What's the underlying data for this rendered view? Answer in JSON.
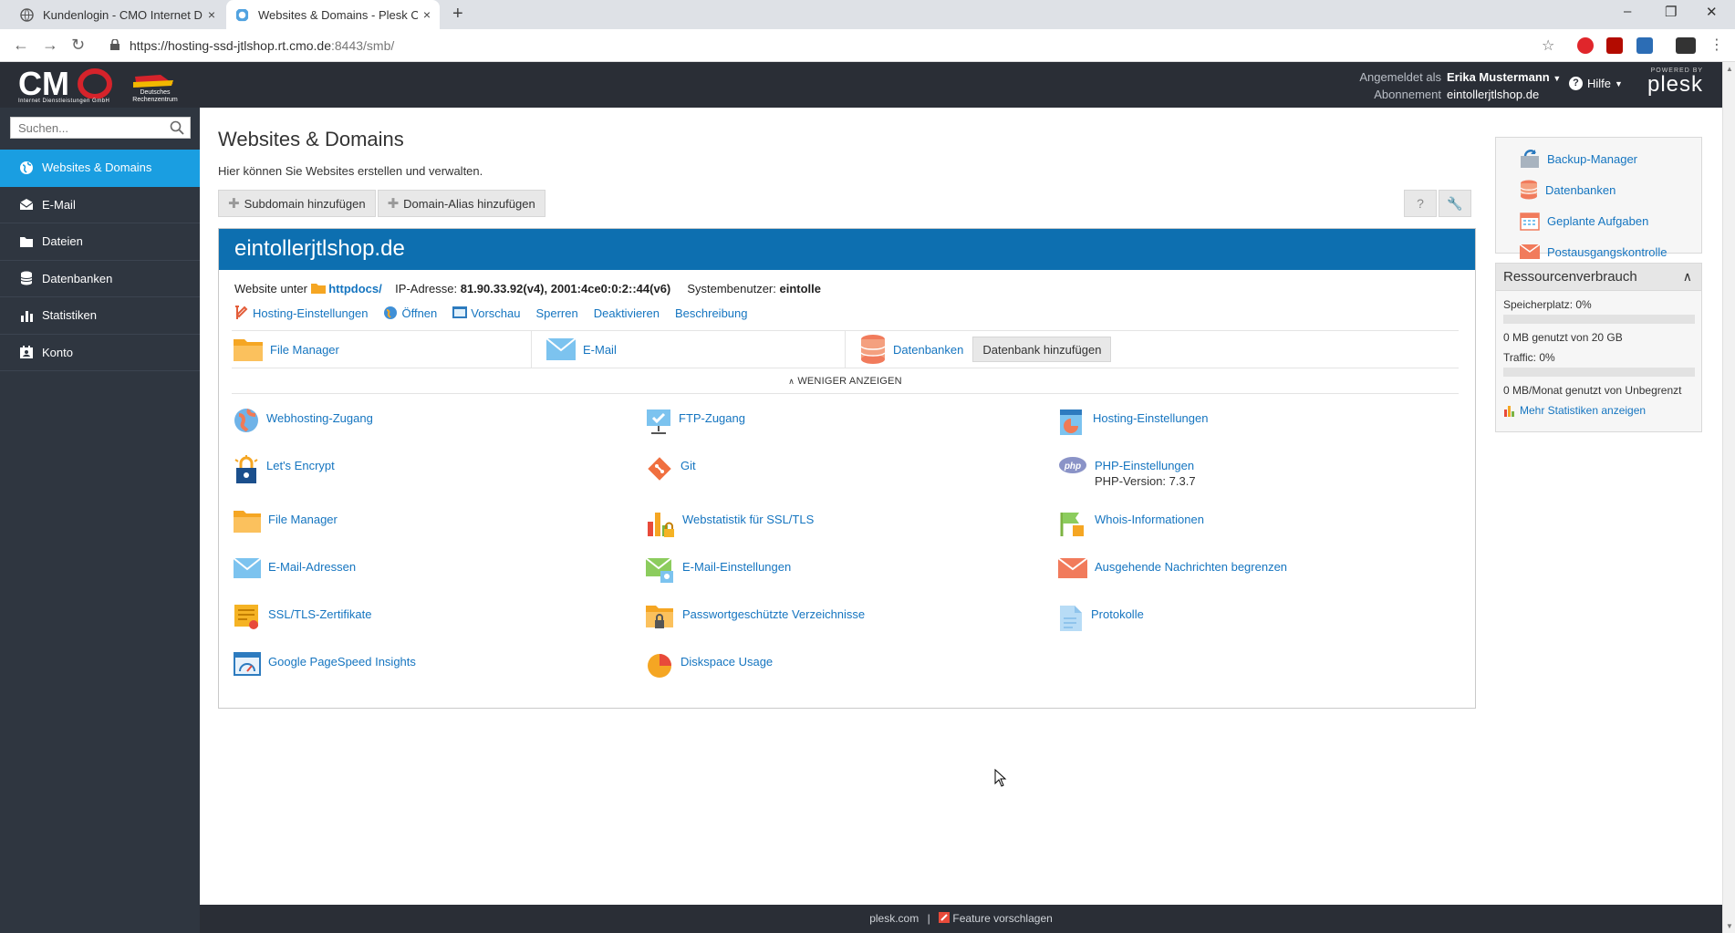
{
  "browser": {
    "tabs": [
      {
        "label": "Kundenlogin - CMO Internet Die",
        "close": "×"
      },
      {
        "label": "Websites & Domains - Plesk Ony",
        "close": "×"
      }
    ],
    "new_tab": "+",
    "url_host": "https://hosting-ssd-jtlshop.rt.cmo.de",
    "url_rest": ":8443/smb/",
    "window_controls": [
      "–",
      "❐",
      "✕"
    ]
  },
  "header": {
    "logo_text": "CMO",
    "logo_sub": "Internet Dienstleistungen GmbH",
    "logo_badge": "Deutsches Rechenzentrum",
    "login_label": "Angemeldet als",
    "login_user": "Erika Mustermann",
    "subscription_label": "Abonnement",
    "subscription_value": "eintollerjtlshop.de",
    "help_label": "Hilfe",
    "powered_by": "POWERED BY",
    "plesk_text": "plesk"
  },
  "sidebar": {
    "search_placeholder": "Suchen...",
    "items": [
      {
        "label": "Websites & Domains",
        "icon": "globe-icon",
        "active": true
      },
      {
        "label": "E-Mail",
        "icon": "mail-icon",
        "active": false
      },
      {
        "label": "Dateien",
        "icon": "folder-icon",
        "active": false
      },
      {
        "label": "Datenbanken",
        "icon": "database-icon",
        "active": false
      },
      {
        "label": "Statistiken",
        "icon": "bar-chart-icon",
        "active": false
      },
      {
        "label": "Konto",
        "icon": "account-icon",
        "active": false
      }
    ]
  },
  "main": {
    "title": "Websites & Domains",
    "description": "Hier können Sie Websites erstellen und verwalten.",
    "toolbar": {
      "add_subdomain": "Subdomain hinzufügen",
      "add_alias": "Domain-Alias hinzufügen",
      "help_btn": "?",
      "tools_btn": "🔧"
    },
    "domain": {
      "name": "eintollerjtlshop.de",
      "website_label": "Website unter",
      "docroot": "httpdocs/",
      "ip_label": "IP-Adresse:",
      "ip_value": "81.90.33.92(v4), 2001:4ce0:0:2::44(v6)",
      "sysuser_label": "Systembenutzer:",
      "sysuser_value": "eintolle",
      "links": {
        "hosting": "Hosting-Einstellungen",
        "open": "Öffnen",
        "preview": "Vorschau",
        "lock": "Sperren",
        "deactivate": "Deaktivieren",
        "description": "Beschreibung"
      },
      "quick": {
        "file_manager": "File Manager",
        "email": "E-Mail",
        "databases": "Datenbanken",
        "add_db": "Datenbank hinzufügen"
      },
      "show_less": "WENIGER ANZEIGEN",
      "features": {
        "webhosting": "Webhosting-Zugang",
        "ftp": "FTP-Zugang",
        "hosting": "Hosting-Einstellungen",
        "letsencrypt": "Let's Encrypt",
        "git": "Git",
        "php": "PHP-Einstellungen",
        "php_version": "PHP-Version: 7.3.7",
        "filemanager": "File Manager",
        "webstat": "Webstatistik für SSL/TLS",
        "whois": "Whois-Informationen",
        "mail_addresses": "E-Mail-Adressen",
        "mail_settings": "E-Mail-Einstellungen",
        "outgoing": "Ausgehende Nachrichten begrenzen",
        "ssl": "SSL/TLS-Zertifikate",
        "protected_dirs": "Passwortgeschützte Verzeichnisse",
        "logs": "Protokolle",
        "pagespeed": "Google PageSpeed Insights",
        "diskspace": "Diskspace Usage"
      }
    }
  },
  "right_panel": {
    "links": {
      "backup": "Backup-Manager",
      "databases": "Datenbanken",
      "scheduled": "Geplante Aufgaben",
      "mailcontrol": "Postausgangskontrolle"
    },
    "resources": {
      "title": "Ressourcenverbrauch",
      "disk_label": "Speicherplatz: 0%",
      "disk_percent": 0,
      "disk_value": "0 MB genutzt von 20 GB",
      "traffic_label": "Traffic: 0%",
      "traffic_percent": 0,
      "traffic_value": "0 MB/Monat genutzt von Unbegrenzt",
      "more_stats": "Mehr Statistiken anzeigen"
    }
  },
  "footer": {
    "plesk_link": "plesk.com",
    "separator": "|",
    "feature": "Feature vorschlagen"
  },
  "colors": {
    "sidebar_bg": "#2f3640",
    "active_blue": "#1a9ee1",
    "domain_header": "#0d6fb0",
    "link": "#1575c0"
  }
}
